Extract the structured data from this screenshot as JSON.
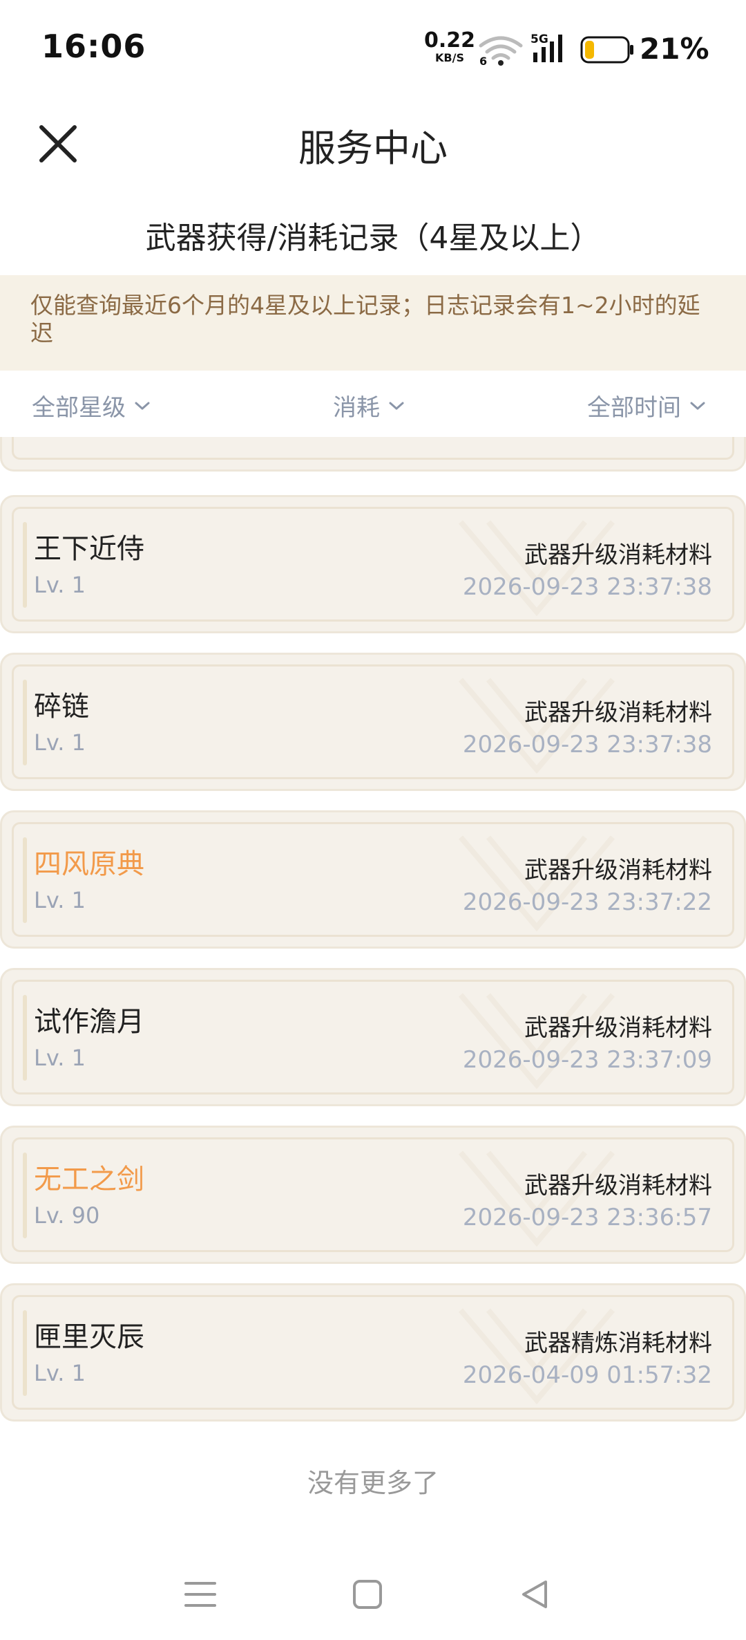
{
  "status_bar": {
    "time": "16:06",
    "net_speed_value": "0.22",
    "net_speed_unit": "KB/S",
    "wifi_badge": "6",
    "network_type": "5G",
    "battery_percent": "21%",
    "battery_level": 0.21,
    "battery_color": "#f5b800"
  },
  "header": {
    "title": "服务中心",
    "close_icon": "close-icon"
  },
  "section_title": "武器获得/消耗记录（4星及以上）",
  "notice": "仅能查询最近6个月的4星及以上记录；日志记录会有1~2小时的延迟",
  "filters": {
    "star": "全部星级",
    "type": "消耗",
    "time": "全部时间"
  },
  "colors": {
    "gold_name": "#f29a4a",
    "notice_bg": "#f6f1e6",
    "notice_text": "#8b6a45",
    "card_bg": "#f5f1ea"
  },
  "records": [
    {
      "name": "王下近侍",
      "level": "Lv. 1",
      "type": "武器升级消耗材料",
      "time": "2026-09-23 23:37:38",
      "highlight": false
    },
    {
      "name": "碎链",
      "level": "Lv. 1",
      "type": "武器升级消耗材料",
      "time": "2026-09-23 23:37:38",
      "highlight": false
    },
    {
      "name": "四风原典",
      "level": "Lv. 1",
      "type": "武器升级消耗材料",
      "time": "2026-09-23 23:37:22",
      "highlight": true
    },
    {
      "name": "试作澹月",
      "level": "Lv. 1",
      "type": "武器升级消耗材料",
      "time": "2026-09-23 23:37:09",
      "highlight": false
    },
    {
      "name": "无工之剑",
      "level": "Lv. 90",
      "type": "武器升级消耗材料",
      "time": "2026-09-23 23:36:57",
      "highlight": true
    },
    {
      "name": "匣里灭辰",
      "level": "Lv. 1",
      "type": "武器精炼消耗材料",
      "time": "2026-04-09 01:57:32",
      "highlight": false
    }
  ],
  "footer": {
    "no_more": "没有更多了"
  },
  "nav": {
    "menu_icon": "menu-icon",
    "home_icon": "home-icon",
    "back_icon": "back-icon"
  }
}
